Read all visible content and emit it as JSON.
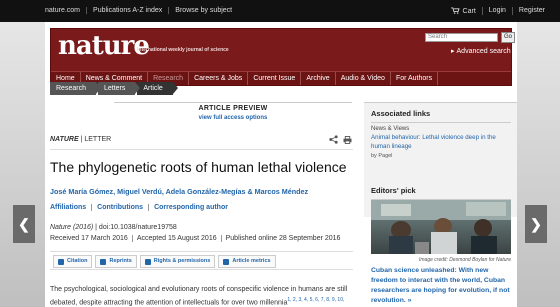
{
  "topbar": {
    "site": "nature.com",
    "links": [
      "Publications A-Z index",
      "Browse by subject"
    ],
    "cart": "Cart",
    "login": "Login",
    "register": "Register"
  },
  "masthead": {
    "logo": "nature",
    "tagline": "International weekly journal of science",
    "search_placeholder": "Search",
    "go": "Go",
    "advanced_search": "Advanced search"
  },
  "nav": [
    "Home",
    "News & Comment",
    "Research",
    "Careers & Jobs",
    "Current Issue",
    "Archive",
    "Audio & Video",
    "For Authors"
  ],
  "breadcrumbs": [
    "Research",
    "Letters",
    "Article"
  ],
  "article": {
    "preview_title": "ARTICLE PREVIEW",
    "preview_options": "view full access options",
    "journal": "NATURE",
    "type": "LETTER",
    "title": "The phylogenetic roots of human lethal violence",
    "authors": "José María Gómez, Miguel Verdú, Adela González-Megías & Marcos Méndez",
    "links": [
      "Affiliations",
      "Contributions",
      "Corresponding author"
    ],
    "citation": "Nature (2016)",
    "doi": "doi:10.1038/nature19758",
    "received": "Received 17 March 2016",
    "accepted": "Accepted 15 August 2016",
    "published": "Published online 28 September 2016",
    "tools": [
      "Citation",
      "Reprints",
      "Rights & permissions",
      "Article metrics"
    ],
    "abstract": "The psychological, sociological and evolutionary roots of conspecific violence in humans are still debated, despite attracting the attention of intellectuals for over two millennia",
    "refs": "1, 2, 3, 4, 5, 6, 7, 8, 9, 10,"
  },
  "associated": {
    "heading": "Associated links",
    "category": "News & Views",
    "link": "Animal behaviour: Lethal violence deep in the human lineage",
    "by": "by Pagel"
  },
  "editors_pick": {
    "heading": "Editors' pick",
    "credit": "Image credit: Desmond Boylan for Nature",
    "text": "Cuban science unleashed: With new freedom to interact with the world, Cuban researchers are hoping for evolution, if not revolution. »"
  },
  "colors": {
    "masthead": "#7a1a1a",
    "link": "#2266aa"
  }
}
